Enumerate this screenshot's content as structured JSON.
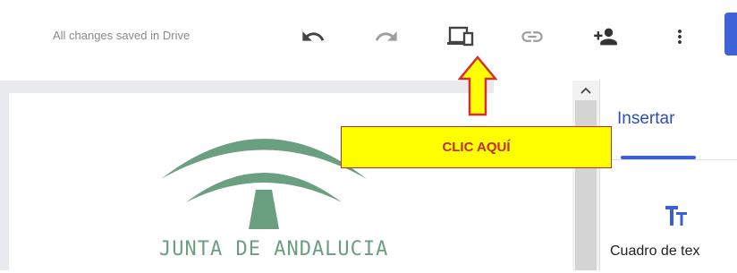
{
  "toolbar": {
    "save_status": "All changes saved in Drive",
    "icons": [
      "undo-icon",
      "redo-icon",
      "preview-device-icon",
      "link-icon",
      "share-icon",
      "more-vert-icon"
    ]
  },
  "logo": {
    "text": "JUNTA DE ANDALUCIA",
    "color": "#6a9f7f"
  },
  "side_panel": {
    "tab_label": "Insertar",
    "item_label": "Cuadro de tex",
    "accent": "#3b5fd4"
  },
  "annotation": {
    "label": "CLIC AQUÍ",
    "background": "#ffff00",
    "text_color": "#c62828"
  }
}
